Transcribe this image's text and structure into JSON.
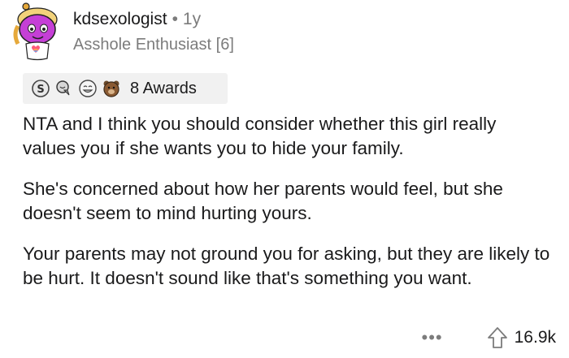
{
  "comment": {
    "username": "kdsexologist",
    "separator": "•",
    "age": "1y",
    "flair": "Asshole Enthusiast [6]",
    "avatar_icon": "snoo-avatar-icon",
    "awards": {
      "icons": [
        "silver-award-icon",
        "wholesome-seal-icon",
        "laughing-face-icon",
        "bear-award-icon"
      ],
      "label": "8 Awards"
    },
    "paragraphs": [
      "NTA and I think you should consider whether this girl really values you if she wants you to hide your family.",
      "She's concerned about how her parents would feel, but she doesn't seem to mind hurting yours.",
      "Your parents may not ground you for asking, but they are likely to be hurt. It doesn't sound like that's something you want."
    ],
    "actions": {
      "more_label": "•••",
      "upvote_icon": "upvote-arrow-icon",
      "score": "16.9k"
    }
  },
  "colors": {
    "text": "#1a1a1b",
    "meta": "#7c7c7c",
    "awards_bg": "#f1f1f1",
    "avatar_face": "#c53fd6"
  }
}
